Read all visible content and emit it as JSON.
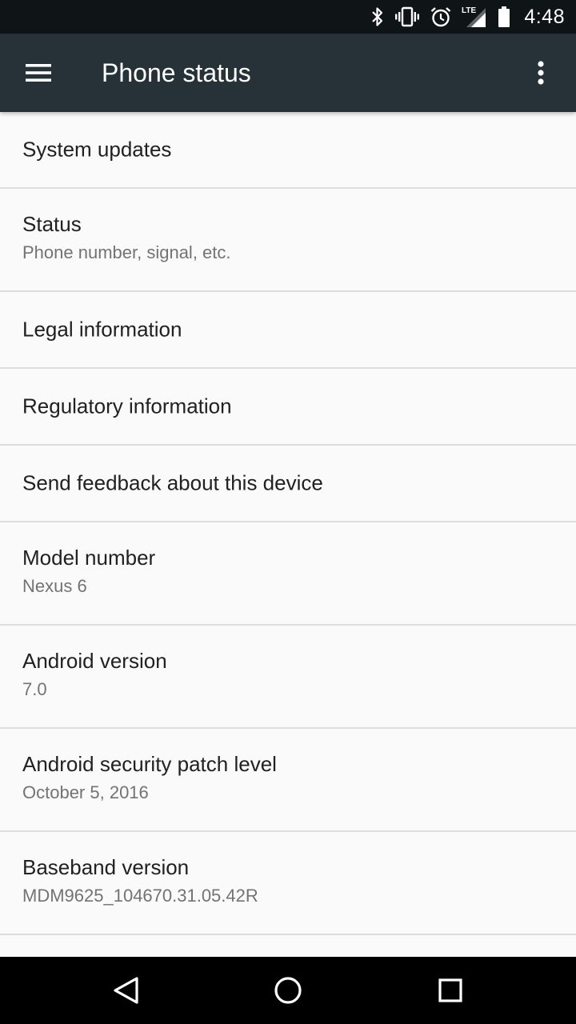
{
  "status_bar": {
    "time": "4:48",
    "network_label": "LTE",
    "icons": [
      "bluetooth-icon",
      "vibrate-icon",
      "alarm-icon",
      "lte-signal-icon",
      "battery-icon"
    ]
  },
  "app_bar": {
    "title": "Phone status",
    "background": "#263238",
    "menu_icon": "hamburger-menu-icon",
    "overflow_icon": "overflow-menu-icon"
  },
  "items": [
    {
      "title": "System updates"
    },
    {
      "title": "Status",
      "subtitle": "Phone number, signal, etc."
    },
    {
      "title": "Legal information"
    },
    {
      "title": "Regulatory information"
    },
    {
      "title": "Send feedback about this device"
    },
    {
      "title": "Model number",
      "subtitle": "Nexus 6"
    },
    {
      "title": "Android version",
      "subtitle": "7.0"
    },
    {
      "title": "Android security patch level",
      "subtitle": "October 5, 2016"
    },
    {
      "title": "Baseband version",
      "subtitle": "MDM9625_104670.31.05.42R"
    }
  ],
  "nav_bar": {
    "icons": [
      "back-icon",
      "home-icon",
      "recents-icon"
    ]
  }
}
